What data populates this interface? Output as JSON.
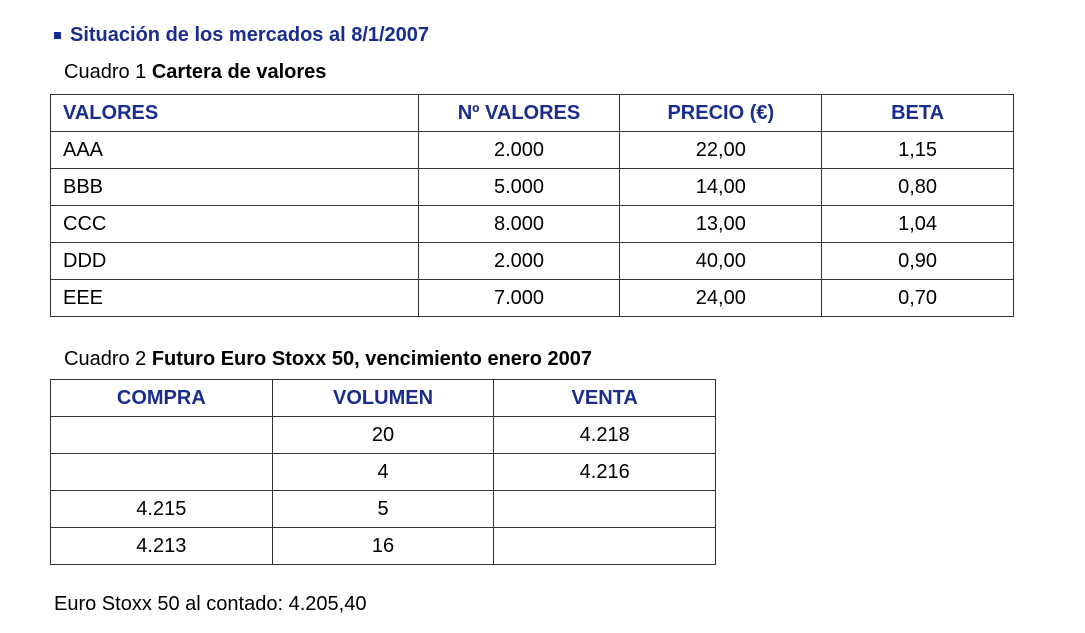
{
  "heading": "Situación de los mercados al 8/1/2007",
  "cuadro1": {
    "label": "Cuadro 1",
    "title": "Cartera de valores",
    "headers": [
      "VALORES",
      "Nº VALORES",
      "PRECIO (€)",
      "BETA"
    ],
    "rows": [
      [
        "AAA",
        "2.000",
        "22,00",
        "1,15"
      ],
      [
        "BBB",
        "5.000",
        "14,00",
        "0,80"
      ],
      [
        "CCC",
        "8.000",
        "13,00",
        "1,04"
      ],
      [
        "DDD",
        "2.000",
        "40,00",
        "0,90"
      ],
      [
        "EEE",
        "7.000",
        "24,00",
        "0,70"
      ]
    ]
  },
  "cuadro2": {
    "label": "Cuadro 2",
    "title": "Futuro Euro Stoxx 50, vencimiento enero 2007",
    "headers": [
      "COMPRA",
      "VOLUMEN",
      "VENTA"
    ],
    "rows": [
      [
        "",
        "20",
        "4.218"
      ],
      [
        "",
        "4",
        "4.216"
      ],
      [
        "4.215",
        "5",
        ""
      ],
      [
        "4.213",
        "16",
        ""
      ]
    ]
  },
  "footer": "Euro Stoxx 50 al contado: 4.205,40",
  "colors": {
    "heading": "#1a2d8c",
    "border": "#333333"
  }
}
